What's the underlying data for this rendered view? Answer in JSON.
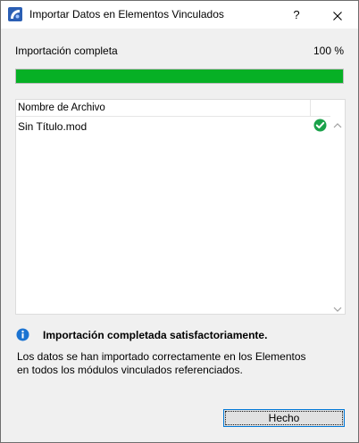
{
  "window": {
    "title": "Importar Datos en Elementos Vinculados",
    "help_label": "?",
    "icons": {
      "app": "app-icon",
      "close": "close-icon"
    }
  },
  "progress": {
    "label": "Importación completa",
    "percent_text": "100 %",
    "value": 1.0,
    "color": "#06b025"
  },
  "file_list": {
    "columns": [
      "Nombre de Archivo"
    ],
    "rows": [
      {
        "name": "Sin Título.mod",
        "status_icon": "check-circle-icon",
        "status_color": "#1aa24a"
      }
    ]
  },
  "message": {
    "icon": "info-icon",
    "icon_color": "#1b73d1",
    "title": "Importación completada satisfactoriamente.",
    "body_lines": [
      "Los datos se han importado correctamente en los Elementos",
      "en todos los módulos vinculados referenciados."
    ]
  },
  "footer": {
    "done_label": "Hecho"
  }
}
